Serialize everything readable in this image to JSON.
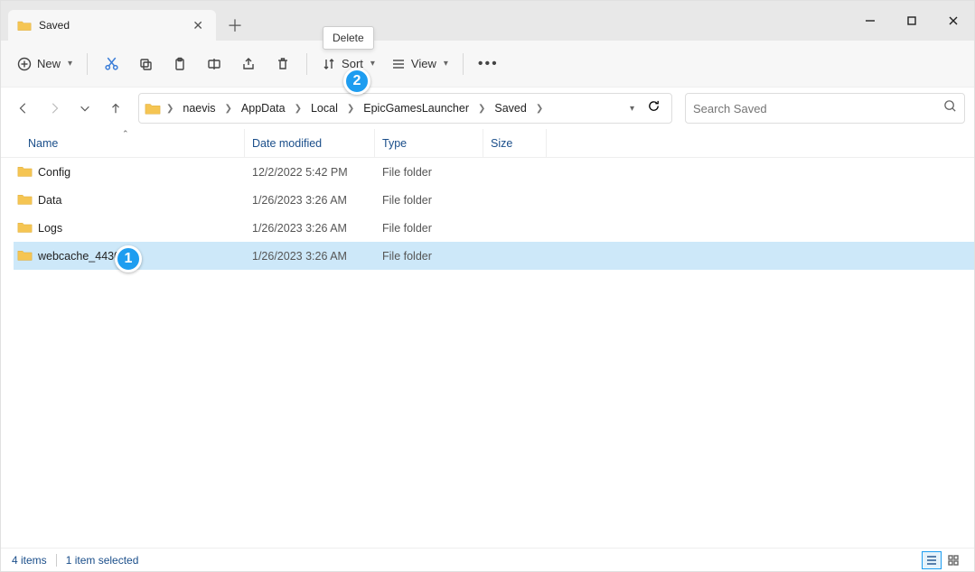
{
  "tab": {
    "title": "Saved"
  },
  "tooltip": {
    "delete": "Delete"
  },
  "toolbar": {
    "new": "New",
    "sort": "Sort",
    "view": "View"
  },
  "breadcrumb": [
    "naevis",
    "AppData",
    "Local",
    "EpicGamesLauncher",
    "Saved"
  ],
  "search": {
    "placeholder": "Search Saved"
  },
  "columns": {
    "name": "Name",
    "date": "Date modified",
    "type": "Type",
    "size": "Size"
  },
  "rows": [
    {
      "name": "Config",
      "date": "12/2/2022 5:42 PM",
      "type": "File folder"
    },
    {
      "name": "Data",
      "date": "1/26/2023 3:26 AM",
      "type": "File folder"
    },
    {
      "name": "Logs",
      "date": "1/26/2023 3:26 AM",
      "type": "File folder"
    },
    {
      "name": "webcache_4430",
      "date": "1/26/2023 3:26 AM",
      "type": "File folder"
    }
  ],
  "status": {
    "count": "4 items",
    "selected": "1 item selected"
  },
  "badges": {
    "one": "1",
    "two": "2"
  }
}
